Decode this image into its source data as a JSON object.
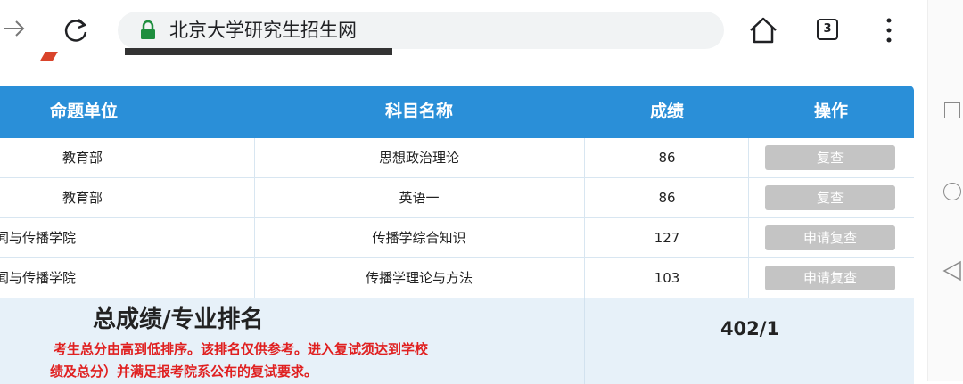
{
  "browser": {
    "url_title": "北京大学研究生招生网",
    "tab_count": "3",
    "icons": [
      "forward-arrow-icon",
      "reload-icon",
      "lock-icon",
      "home-icon",
      "tabs-icon",
      "more-menu-icon"
    ],
    "lock_color": "#1e8e3e"
  },
  "table": {
    "accent_color": "#2a8fd8",
    "headers": {
      "unit": "命题单位",
      "subject": "科目名称",
      "score": "成绩",
      "action": "操作"
    },
    "rows": [
      {
        "unit": "教育部",
        "subject": "思想政治理论",
        "score": "86",
        "action": "复查"
      },
      {
        "unit": "教育部",
        "subject": "英语一",
        "score": "86",
        "action": "复查"
      },
      {
        "unit": "闻与传播学院",
        "subject": "传播学综合知识",
        "score": "127",
        "action": "申请复查"
      },
      {
        "unit": "闻与传播学院",
        "subject": "传播学理论与方法",
        "score": "103",
        "action": "申请复查"
      }
    ],
    "total": {
      "title": "总成绩/专业排名",
      "note_line1": "考生总分由高到低排序。该排名仅供参考。进入复试须达到学校",
      "note_line2": "绩及总分）并满足报考院系公布的复试要求。",
      "value": "402/1"
    }
  }
}
